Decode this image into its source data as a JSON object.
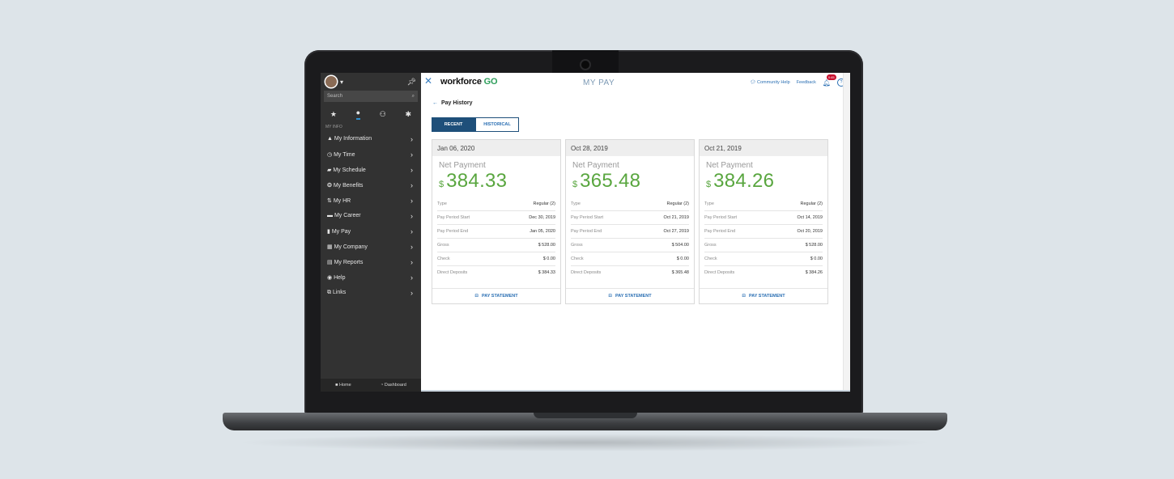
{
  "header": {
    "app_close_icon": "close-icon",
    "logo_text": "workforce",
    "logo_accent": "GO",
    "title": "MY PAY",
    "community_help": "Community Help",
    "feedback": "Feedback",
    "notification_count": "0:45"
  },
  "sidebar": {
    "search_placeholder": "Search",
    "section_label": "MY INFO",
    "items": [
      {
        "label": "My Information",
        "icon": "person-icon",
        "glyph": "▲"
      },
      {
        "label": "My Time",
        "icon": "clock-icon",
        "glyph": "◷"
      },
      {
        "label": "My Schedule",
        "icon": "schedule-icon",
        "glyph": "▰"
      },
      {
        "label": "My Benefits",
        "icon": "benefits-icon",
        "glyph": "❂"
      },
      {
        "label": "My HR",
        "icon": "hr-icon",
        "glyph": "⇅"
      },
      {
        "label": "My Career",
        "icon": "briefcase-icon",
        "glyph": "▬"
      },
      {
        "label": "My Pay",
        "icon": "pay-icon",
        "glyph": "▮"
      },
      {
        "label": "My Company",
        "icon": "company-icon",
        "glyph": "▦"
      },
      {
        "label": "My Reports",
        "icon": "reports-icon",
        "glyph": "▤"
      },
      {
        "label": "Help",
        "icon": "help-icon",
        "glyph": "◉"
      },
      {
        "label": "Links",
        "icon": "external-link-icon",
        "glyph": "⧉"
      }
    ],
    "bottom": {
      "home": "Home",
      "dashboard": "Dashboard"
    }
  },
  "main": {
    "breadcrumb": "Pay History",
    "tabs": [
      {
        "label": "RECENT"
      },
      {
        "label": "HISTORICAL"
      }
    ],
    "net_label": "Net Payment",
    "currency": "$",
    "statement_label": "PAY STATEMENT",
    "row_labels": [
      "Type",
      "Pay Period Start",
      "Pay Period End",
      "Gross",
      "Check",
      "Direct Deposits"
    ],
    "cards": [
      {
        "date": "Jan 06, 2020",
        "net": "384.33",
        "values": [
          "Regular (2)",
          "Dec 30, 2019",
          "Jan 05, 2020",
          "$ 528.00",
          "$ 0.00",
          "$ 384.33"
        ]
      },
      {
        "date": "Oct 28, 2019",
        "net": "365.48",
        "values": [
          "Regular (2)",
          "Oct 21, 2019",
          "Oct 27, 2019",
          "$ 504.00",
          "$ 0.00",
          "$ 365.48"
        ]
      },
      {
        "date": "Oct 21, 2019",
        "net": "384.26",
        "values": [
          "Regular (2)",
          "Oct 14, 2019",
          "Oct 20, 2019",
          "$ 528.00",
          "$ 0.00",
          "$ 384.26"
        ]
      }
    ]
  },
  "colors": {
    "accent": "#2a6fb3",
    "amount_green": "#59a63f",
    "tab_active": "#1e4f7a",
    "sidebar_bg": "#323232"
  }
}
